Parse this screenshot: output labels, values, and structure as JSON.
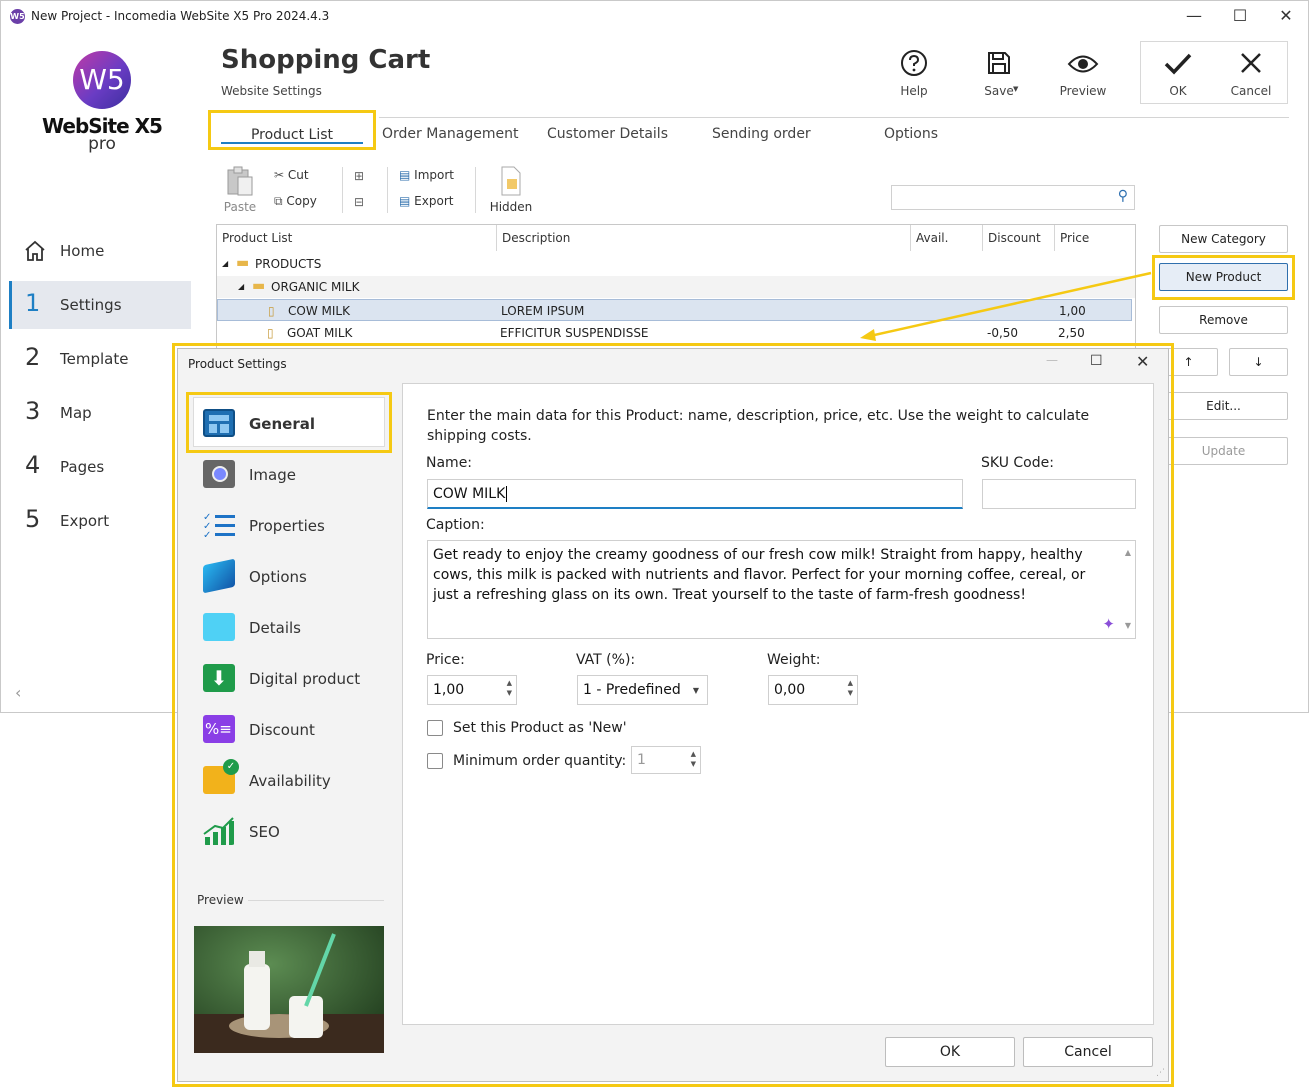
{
  "window": {
    "title": "New Project - Incomedia WebSite X5 Pro 2024.4.3",
    "minimize": "—",
    "maximize": "☐",
    "close": "✕"
  },
  "logo": {
    "mark": "W5",
    "name": "WebSite X5",
    "edition": "pro"
  },
  "nav": {
    "home": "Home",
    "items": [
      {
        "num": "1",
        "label": "Settings"
      },
      {
        "num": "2",
        "label": "Template"
      },
      {
        "num": "3",
        "label": "Map"
      },
      {
        "num": "4",
        "label": "Pages"
      },
      {
        "num": "5",
        "label": "Export"
      }
    ],
    "collapse": "‹"
  },
  "header": {
    "title": "Shopping Cart",
    "subtitle": "Website Settings",
    "help": "Help",
    "save": "Save",
    "preview": "Preview",
    "ok": "OK",
    "cancel": "Cancel"
  },
  "tabs": [
    "Product List",
    "Order Management",
    "Customer Details",
    "Sending order",
    "Options"
  ],
  "toolbar": {
    "paste": "Paste",
    "cut": "Cut",
    "copy": "Copy",
    "import": "Import",
    "export": "Export",
    "hidden": "Hidden"
  },
  "table": {
    "columns": [
      "Product List",
      "Description",
      "Avail.",
      "Discount",
      "Price"
    ],
    "rows": [
      {
        "name": "PRODUCTS",
        "desc": "",
        "discount": "",
        "price": ""
      },
      {
        "name": "ORGANIC MILK",
        "desc": "",
        "discount": "",
        "price": ""
      },
      {
        "name": "COW MILK",
        "desc": "LOREM IPSUM",
        "discount": "",
        "price": "1,00"
      },
      {
        "name": "GOAT MILK",
        "desc": "EFFICITUR SUSPENDISSE",
        "discount": "-0,50",
        "price": "2,50"
      }
    ]
  },
  "side_buttons": {
    "new_category": "New Category",
    "new_product": "New Product",
    "remove": "Remove",
    "up": "↑",
    "down": "↓",
    "edit": "Edit...",
    "update": "Update"
  },
  "dialog": {
    "title": "Product Settings",
    "categories": [
      "General",
      "Image",
      "Properties",
      "Options",
      "Details",
      "Digital product",
      "Discount",
      "Availability",
      "SEO"
    ],
    "preview_label": "Preview",
    "intro": "Enter the main data for this Product: name, description, price, etc. Use the weight to calculate shipping costs.",
    "name_label": "Name:",
    "name_value": "COW MILK",
    "sku_label": "SKU Code:",
    "sku_value": "",
    "caption_label": "Caption:",
    "caption_value": "Get ready to enjoy the creamy goodness of our fresh cow milk! Straight from happy, healthy cows, this milk is packed with nutrients and flavor. Perfect for your morning coffee, cereal, or just a refreshing glass on its own. Treat yourself to the taste of farm-fresh goodness!",
    "price_label": "Price:",
    "price_value": "1,00",
    "vat_label": "VAT (%):",
    "vat_value": "1 - Predefined",
    "weight_label": "Weight:",
    "weight_value": "0,00",
    "new_check_label": "Set this Product as 'New'",
    "min_qty_label": "Minimum order quantity:",
    "min_qty_value": "1",
    "ok": "OK",
    "cancel": "Cancel"
  },
  "colors": {
    "accent": "#1e7fc4",
    "highlight": "#f5c913",
    "selection": "#dbe4f0"
  }
}
